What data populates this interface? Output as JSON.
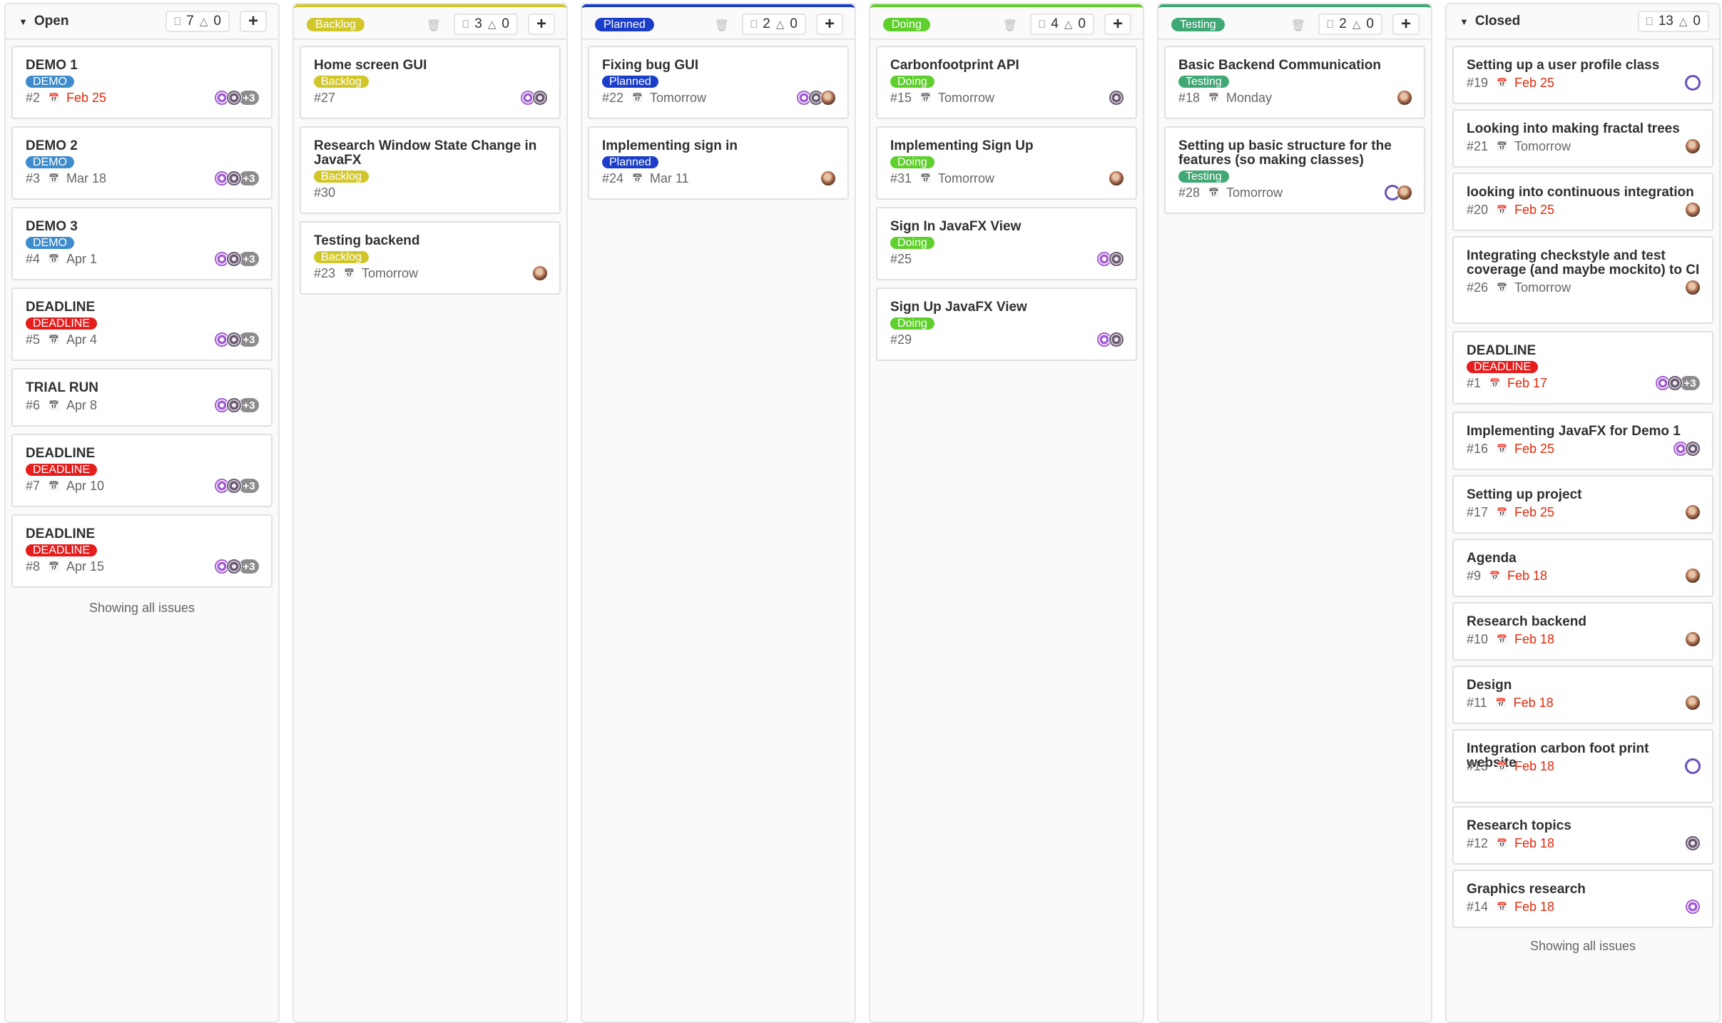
{
  "colors": {
    "backlog": "#d1c72b",
    "planned": "#1a3ec9",
    "doing": "#5fcf2d",
    "testing": "#3fa875",
    "demo": "#3f8ccc",
    "deadline": "#e41d1d",
    "overdue": "#dd2b0e"
  },
  "columns": [
    {
      "title": "Open",
      "issue_count": "7",
      "weight": "0",
      "footer": "Showing all issues",
      "cards": [
        {
          "title": "DEMO 1",
          "label": "DEMO",
          "number": "#2",
          "due": "Feb 25",
          "overdue": true,
          "assignees": [
            "purple",
            "grey"
          ],
          "more": "+3"
        },
        {
          "title": "DEMO 2",
          "label": "DEMO",
          "number": "#3",
          "due": "Mar 18",
          "overdue": false,
          "assignees": [
            "purple",
            "grey"
          ],
          "more": "+3"
        },
        {
          "title": "DEMO 3",
          "label": "DEMO",
          "number": "#4",
          "due": "Apr 1",
          "overdue": false,
          "assignees": [
            "purple",
            "grey"
          ],
          "more": "+3"
        },
        {
          "title": "DEADLINE",
          "label": "DEADLINE",
          "number": "#5",
          "due": "Apr 4",
          "overdue": false,
          "assignees": [
            "purple",
            "grey"
          ],
          "more": "+3"
        },
        {
          "title": "TRIAL RUN",
          "label": "",
          "number": "#6",
          "due": "Apr 8",
          "overdue": false,
          "assignees": [
            "purple",
            "grey"
          ],
          "more": "+3"
        },
        {
          "title": "DEADLINE",
          "label": "DEADLINE",
          "number": "#7",
          "due": "Apr 10",
          "overdue": false,
          "assignees": [
            "purple",
            "grey"
          ],
          "more": "+3"
        },
        {
          "title": "DEADLINE",
          "label": "DEADLINE",
          "number": "#8",
          "due": "Apr 15",
          "overdue": false,
          "assignees": [
            "purple",
            "grey"
          ],
          "more": "+3"
        }
      ]
    },
    {
      "title": "Backlog",
      "issue_count": "3",
      "weight": "0",
      "cards": [
        {
          "title": "Home screen GUI",
          "label": "Backlog",
          "number": "#27",
          "due": "",
          "overdue": false,
          "assignees": [
            "purple",
            "grey"
          ],
          "more": ""
        },
        {
          "title": "Research Window State Change in JavaFX",
          "label": "Backlog",
          "number": "#30",
          "due": "",
          "overdue": false,
          "assignees": [],
          "more": ""
        },
        {
          "title": "Testing backend",
          "label": "Backlog",
          "number": "#23",
          "due": "Tomorrow",
          "overdue": false,
          "assignees": [
            "photo"
          ],
          "more": ""
        }
      ]
    },
    {
      "title": "Planned",
      "issue_count": "2",
      "weight": "0",
      "cards": [
        {
          "title": "Fixing bug GUI",
          "label": "Planned",
          "number": "#22",
          "due": "Tomorrow",
          "overdue": false,
          "assignees": [
            "purple",
            "grey",
            "photo"
          ],
          "more": ""
        },
        {
          "title": "Implementing sign in",
          "label": "Planned",
          "number": "#24",
          "due": "Mar 11",
          "overdue": false,
          "assignees": [
            "photo"
          ],
          "more": ""
        }
      ]
    },
    {
      "title": "Doing",
      "issue_count": "4",
      "weight": "0",
      "cards": [
        {
          "title": "Carbonfootprint API",
          "label": "Doing",
          "number": "#15",
          "due": "Tomorrow",
          "overdue": false,
          "assignees": [
            "grey"
          ],
          "more": ""
        },
        {
          "title": "Implementing Sign Up",
          "label": "Doing",
          "number": "#31",
          "due": "Tomorrow",
          "overdue": false,
          "assignees": [
            "photo"
          ],
          "more": ""
        },
        {
          "title": "Sign In JavaFX View",
          "label": "Doing",
          "number": "#25",
          "due": "",
          "overdue": false,
          "assignees": [
            "purple",
            "grey"
          ],
          "more": ""
        },
        {
          "title": "Sign Up JavaFX View",
          "label": "Doing",
          "number": "#29",
          "due": "",
          "overdue": false,
          "assignees": [
            "purple",
            "grey"
          ],
          "more": ""
        }
      ]
    },
    {
      "title": "Testing",
      "issue_count": "2",
      "weight": "0",
      "cards": [
        {
          "title": "Basic Backend Communication",
          "label": "Testing",
          "number": "#18",
          "due": "Monday",
          "overdue": false,
          "assignees": [
            "photo"
          ],
          "more": ""
        },
        {
          "title": "Setting up basic structure for the features (so making classes)",
          "label": "Testing",
          "number": "#28",
          "due": "Tomorrow",
          "overdue": false,
          "assignees": [
            "ring",
            "photo"
          ],
          "more": ""
        }
      ]
    },
    {
      "title": "Closed",
      "issue_count": "13",
      "weight": "0",
      "footer": "Showing all issues",
      "cards": [
        {
          "title": "Setting up a user profile class",
          "label": "",
          "number": "#19",
          "due": "Feb 25",
          "overdue": true,
          "assignees": [
            "ring"
          ],
          "more": ""
        },
        {
          "title": "Looking into making fractal trees",
          "label": "",
          "number": "#21",
          "due": "Tomorrow",
          "overdue": false,
          "assignees": [
            "photo"
          ],
          "more": ""
        },
        {
          "title": "looking into continuous integration",
          "label": "",
          "number": "#20",
          "due": "Feb 25",
          "overdue": true,
          "assignees": [
            "photo"
          ],
          "more": ""
        },
        {
          "title": "Integrating checkstyle and test coverage (and maybe mockito) to CI",
          "label": "",
          "number": "#26",
          "due": "Tomorrow",
          "overdue": false,
          "assignees": [
            "photo"
          ],
          "more": ""
        },
        {
          "title": "DEADLINE",
          "label": "DEADLINE",
          "number": "#1",
          "due": "Feb 17",
          "overdue": true,
          "assignees": [
            "purple",
            "grey"
          ],
          "more": "+3"
        },
        {
          "title": "Implementing JavaFX for Demo 1",
          "label": "",
          "number": "#16",
          "due": "Feb 25",
          "overdue": true,
          "assignees": [
            "purple",
            "grey"
          ],
          "more": ""
        },
        {
          "title": "Setting up project",
          "label": "",
          "number": "#17",
          "due": "Feb 25",
          "overdue": true,
          "assignees": [
            "photo"
          ],
          "more": ""
        },
        {
          "title": "Agenda",
          "label": "",
          "number": "#9",
          "due": "Feb 18",
          "overdue": true,
          "assignees": [
            "photo"
          ],
          "more": ""
        },
        {
          "title": "Research backend",
          "label": "",
          "number": "#10",
          "due": "Feb 18",
          "overdue": true,
          "assignees": [
            "photo"
          ],
          "more": ""
        },
        {
          "title": "Design",
          "label": "",
          "number": "#11",
          "due": "Feb 18",
          "overdue": true,
          "assignees": [
            "photo"
          ],
          "more": ""
        },
        {
          "title": "Integration carbon foot print website",
          "label": "",
          "number": "#13",
          "due": "Feb 18",
          "overdue": true,
          "assignees": [
            "ring"
          ],
          "more": ""
        },
        {
          "title": "Research topics",
          "label": "",
          "number": "#12",
          "due": "Feb 18",
          "overdue": true,
          "assignees": [
            "grey"
          ],
          "more": ""
        },
        {
          "title": "Graphics research",
          "label": "",
          "number": "#14",
          "due": "Feb 18",
          "overdue": true,
          "assignees": [
            "purple"
          ],
          "more": ""
        }
      ]
    }
  ]
}
